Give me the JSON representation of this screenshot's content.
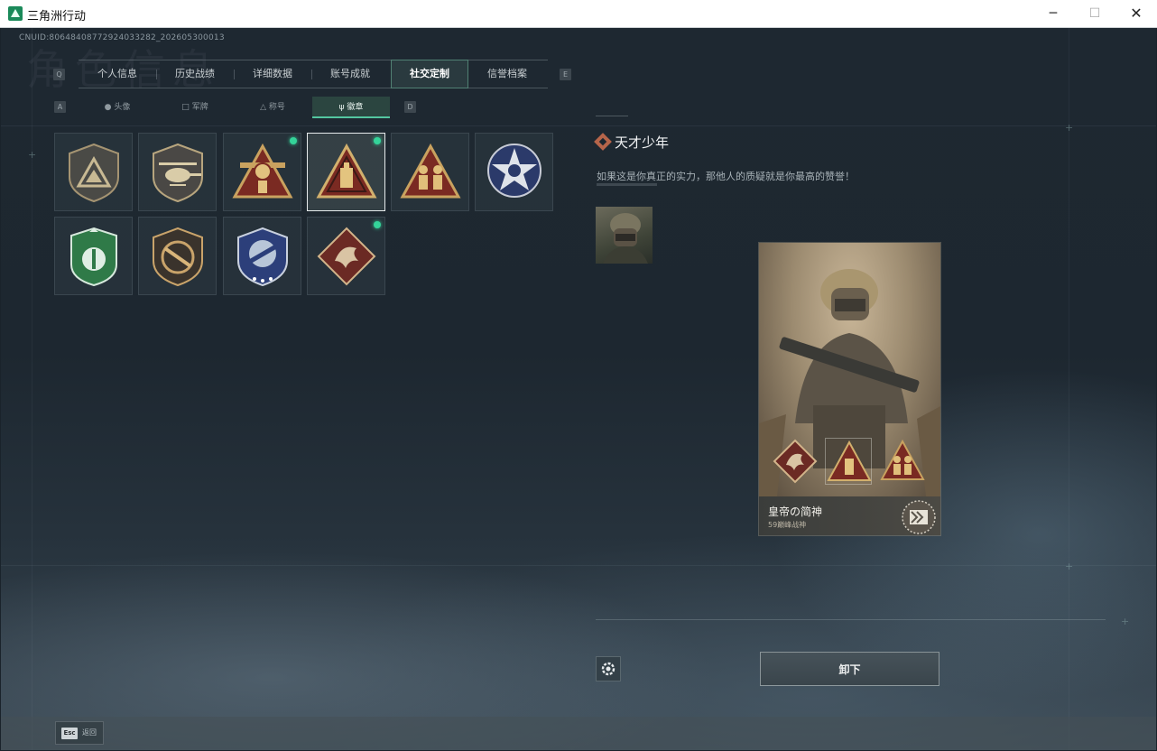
{
  "window": {
    "title": "三角洲行动",
    "minimize": "─",
    "maximize": "☐",
    "close": "✕"
  },
  "header": {
    "uid": "CNUID:8064840877292403328​2_202605300013",
    "bg_title": "角色信息"
  },
  "tabs": {
    "left_key": "Q",
    "right_key": "E",
    "items": [
      {
        "label": "个人信息"
      },
      {
        "label": "历史战绩"
      },
      {
        "label": "详细数据"
      },
      {
        "label": "账号成就"
      },
      {
        "label": "社交定制",
        "active": true
      },
      {
        "label": "信誉档案"
      }
    ]
  },
  "subtabs": {
    "left_key": "A",
    "right_key": "D",
    "items": [
      {
        "icon": "person-icon",
        "label": "头像"
      },
      {
        "icon": "banner-icon",
        "label": "军牌"
      },
      {
        "icon": "triangle-icon",
        "label": "称号"
      },
      {
        "icon": "emblem-icon",
        "label": "徽章",
        "active": true
      }
    ]
  },
  "badges": [
    {
      "icon": "triangle-shield-badge-icon"
    },
    {
      "icon": "helicopter-shield-badge-icon"
    },
    {
      "icon": "59-triangle-badge-icon",
      "new": true
    },
    {
      "icon": "tower-triangle-badge-icon",
      "selected": true,
      "new": true
    },
    {
      "icon": "soldiers-triangle-badge-icon"
    },
    {
      "icon": "star-skull-badge-icon"
    },
    {
      "icon": "green-shield-badge-icon"
    },
    {
      "icon": "rifle-shield-badge-icon"
    },
    {
      "icon": "blue-crest-badge-icon"
    },
    {
      "icon": "dragon-diamond-badge-icon",
      "new": true
    }
  ],
  "detail": {
    "title": "天才少年",
    "description": "如果这是你真正的实力，那他人的质疑就是你最高的赞誉！"
  },
  "card": {
    "name": "皇帝の简神",
    "subtitle": "59巅峰战神"
  },
  "actions": {
    "unequip_label": "卸下"
  },
  "footer": {
    "esc_key": "Esc",
    "esc_label": "返回"
  },
  "colors": {
    "accent_green": "#34d399",
    "active_tab_bg": "#2a3a3f",
    "badge_bronze": "#b88a52",
    "badge_red": "#7a2a22"
  }
}
